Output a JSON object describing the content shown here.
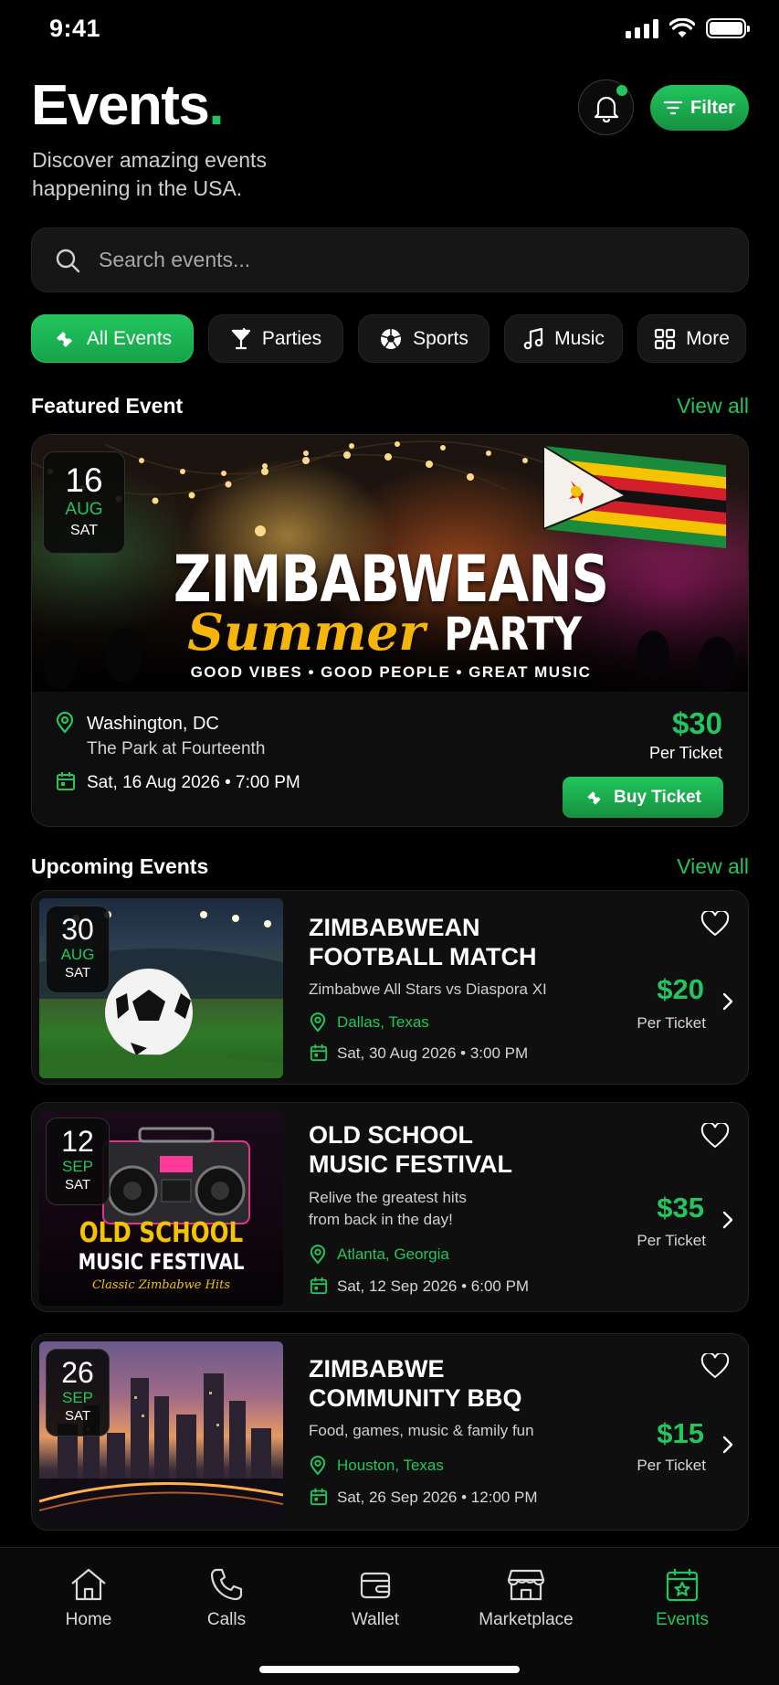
{
  "status_bar": {
    "time": "9:41"
  },
  "header": {
    "title": "Events",
    "title_dot": ".",
    "subtitle": "Discover amazing events happening in the USA.",
    "filter_label": "Filter"
  },
  "search": {
    "placeholder": "Search events..."
  },
  "categories": [
    {
      "label": "All Events",
      "icon": "ticket-icon",
      "active": true
    },
    {
      "label": "Parties",
      "icon": "cocktail-icon",
      "active": false
    },
    {
      "label": "Sports",
      "icon": "soccer-ball-icon",
      "active": false
    },
    {
      "label": "Music",
      "icon": "music-note-icon",
      "active": false
    },
    {
      "label": "More",
      "icon": "grid-icon",
      "active": false
    }
  ],
  "featured": {
    "section_title": "Featured Event",
    "view_all": "View all",
    "date_day": "16",
    "date_month": "AUG",
    "date_weekday": "SAT",
    "banner_line1": "ZIMBABWEANS",
    "banner_script": "Summer",
    "banner_party": "PARTY",
    "banner_tagline": "GOOD VIBES • GOOD PEOPLE • GREAT MUSIC",
    "city": "Washington, DC",
    "venue": "The Park at Fourteenth",
    "datetime": "Sat, 16 Aug 2026 • 7:00 PM",
    "price": "$30",
    "per_ticket": "Per Ticket",
    "buy_label": "Buy Ticket"
  },
  "upcoming": {
    "section_title": "Upcoming Events",
    "view_all": "View all",
    "events": [
      {
        "title": "ZIMBABWEAN FOOTBALL MATCH",
        "subtitle": "Zimbabwe All Stars vs Diaspora XI",
        "city": "Dallas, Texas",
        "datetime": "Sat, 30 Aug 2026 • 3:00 PM",
        "price": "$20",
        "per_ticket": "Per Ticket",
        "date_day": "30",
        "date_month": "AUG",
        "date_weekday": "SAT"
      },
      {
        "title": "OLD SCHOOL MUSIC FESTIVAL",
        "subtitle": "Relive the greatest hits from back in the day!",
        "city": "Atlanta, Georgia",
        "datetime": "Sat, 12 Sep 2026 • 6:00 PM",
        "price": "$35",
        "per_ticket": "Per Ticket",
        "date_day": "12",
        "date_month": "SEP",
        "date_weekday": "SAT",
        "poster_line1": "OLD SCHOOL",
        "poster_line2": "MUSIC FESTIVAL",
        "poster_line3": "Classic Zimbabwe Hits"
      },
      {
        "title": "ZIMBABWE COMMUNITY BBQ",
        "subtitle": "Food, games, music & family fun",
        "city": "Houston, Texas",
        "datetime": "Sat, 26 Sep 2026 • 12:00 PM",
        "price": "$15",
        "per_ticket": "Per Ticket",
        "date_day": "26",
        "date_month": "SEP",
        "date_weekday": "SAT"
      }
    ]
  },
  "tabbar": [
    {
      "label": "Home",
      "icon": "home-icon",
      "active": false
    },
    {
      "label": "Calls",
      "icon": "phone-icon",
      "active": false
    },
    {
      "label": "Wallet",
      "icon": "wallet-icon",
      "active": false
    },
    {
      "label": "Marketplace",
      "icon": "store-icon",
      "active": false
    },
    {
      "label": "Events",
      "icon": "calendar-star-icon",
      "active": true
    }
  ],
  "colors": {
    "accent": "#22c55e",
    "background": "#000000",
    "card": "#0f0f0f"
  }
}
